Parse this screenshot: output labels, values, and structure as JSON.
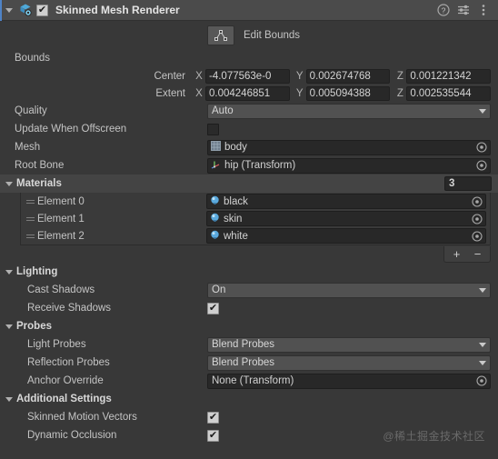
{
  "header": {
    "title": "Skinned Mesh Renderer",
    "enabled": true,
    "check_glyph": "✔",
    "component_icon": "skinned-mesh-renderer-icon",
    "help_label": "?",
    "buttons": [
      "help-icon",
      "preset-icon",
      "menu-icon"
    ]
  },
  "edit_bounds": {
    "label": "Edit Bounds",
    "icon": "edit-bounds-icon"
  },
  "bounds": {
    "label": "Bounds",
    "center": {
      "label": "Center",
      "axes": [
        "X",
        "Y",
        "Z"
      ],
      "values": [
        "-4.077563e-0",
        "0.002674768",
        "0.001221342"
      ]
    },
    "extent": {
      "label": "Extent",
      "axes": [
        "X",
        "Y",
        "Z"
      ],
      "values": [
        "0.004246851",
        "0.005094388",
        "0.002535544"
      ]
    }
  },
  "quality": {
    "label": "Quality",
    "value": "Auto"
  },
  "update_offscreen": {
    "label": "Update When Offscreen",
    "checked": false
  },
  "mesh": {
    "label": "Mesh",
    "value": "body",
    "icon": "mesh-icon"
  },
  "root_bone": {
    "label": "Root Bone",
    "value": "hip (Transform)",
    "icon": "transform-icon"
  },
  "materials": {
    "label": "Materials",
    "count": "3",
    "elements": [
      {
        "label": "Element 0",
        "value": "black",
        "icon": "material-icon"
      },
      {
        "label": "Element 1",
        "value": "skin",
        "icon": "material-icon"
      },
      {
        "label": "Element 2",
        "value": "white",
        "icon": "material-icon"
      }
    ],
    "add_label": "+",
    "remove_label": "−"
  },
  "lighting": {
    "label": "Lighting",
    "cast_shadows": {
      "label": "Cast Shadows",
      "value": "On"
    },
    "receive_shadows": {
      "label": "Receive Shadows",
      "checked": true
    }
  },
  "probes": {
    "label": "Probes",
    "light_probes": {
      "label": "Light Probes",
      "value": "Blend Probes"
    },
    "reflection_probes": {
      "label": "Reflection Probes",
      "value": "Blend Probes"
    },
    "anchor_override": {
      "label": "Anchor Override",
      "value": "None (Transform)"
    }
  },
  "additional_settings": {
    "label": "Additional Settings",
    "skinned_motion_vectors": {
      "label": "Skinned Motion Vectors",
      "checked": true
    },
    "dynamic_occlusion": {
      "label": "Dynamic Occlusion",
      "checked": true
    }
  },
  "watermark": "@稀土掘金技术社区",
  "colors": {
    "background": "#383838",
    "header": "#4b4b4b",
    "accent": "#4f83c7",
    "field_dark": "#282828",
    "dropdown": "#515151",
    "material_sphere": "#5aa9dd"
  }
}
